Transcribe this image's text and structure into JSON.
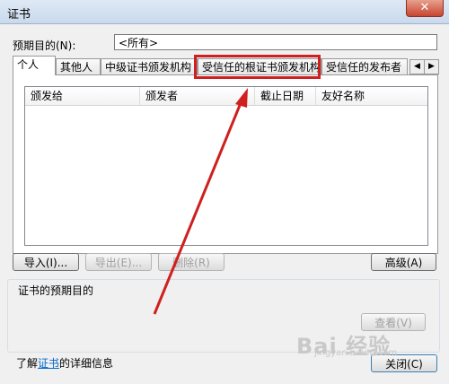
{
  "window": {
    "title": "证书",
    "close_label": "✕"
  },
  "purpose": {
    "label": "预期目的(N):",
    "value": "<所有>"
  },
  "tabs": [
    "个人",
    "其他人",
    "中级证书颁发机构",
    "受信任的根证书颁发机构",
    "受信任的发布者"
  ],
  "tab_scroll": {
    "left": "◀",
    "right": "▶"
  },
  "list": {
    "columns": [
      "颁发给",
      "颁发者",
      "截止日期",
      "友好名称"
    ],
    "rows": []
  },
  "buttons": {
    "import": "导入(I)...",
    "export": "导出(E)...",
    "remove": "删除(R)",
    "advanced": "高级(A)",
    "view": "查看(V)",
    "close": "关闭(C)"
  },
  "group": {
    "title": "证书的预期目的"
  },
  "learn": {
    "prefix": "了解",
    "link": "证书",
    "suffix": "的详细信息"
  },
  "annotation": {
    "color": "#d01f1f"
  },
  "watermark": {
    "text": "Bai 经验",
    "url": "jingyan.baidu.com"
  }
}
